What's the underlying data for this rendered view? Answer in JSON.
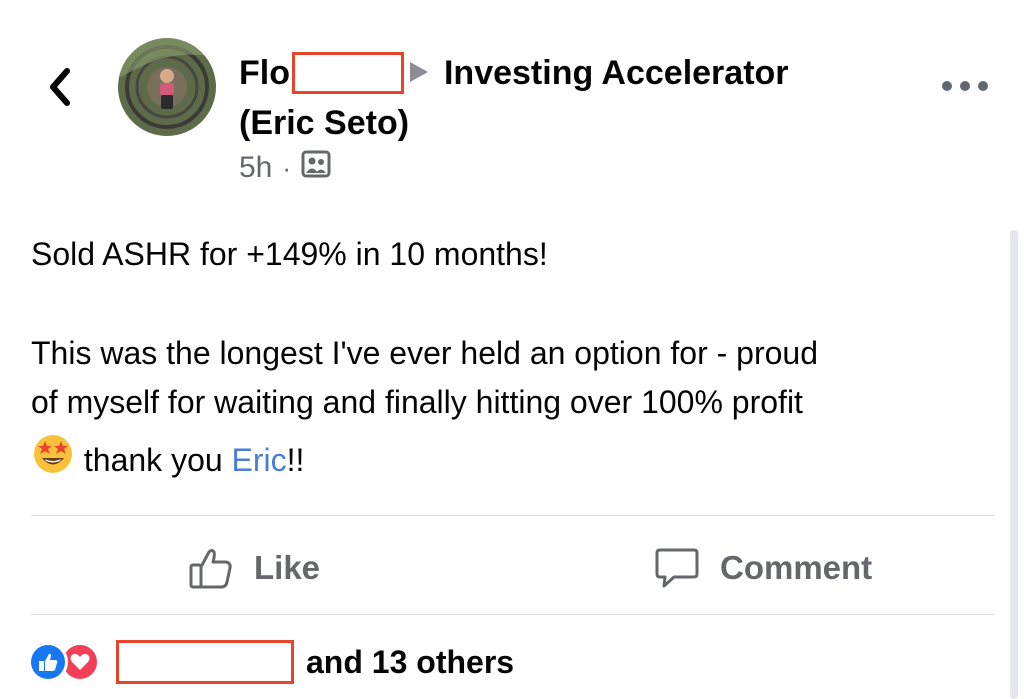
{
  "header": {
    "back_icon": "chevron-left-icon",
    "author_name_prefix": "Flo",
    "group_name": "Investing Accelerator",
    "group_owner": "(Eric Seto)",
    "timestamp": "5h",
    "separator": "·",
    "privacy_icon": "group-members-icon",
    "more_icon": "more-horizontal-icon"
  },
  "post": {
    "line1": "Sold ASHR for +149% in 10 months!",
    "line2": "This was the longest I've ever held an option for - proud",
    "line3": "of myself for waiting and finally hitting over 100% profit",
    "emoji": "star-struck-emoji",
    "thanks_text": " thank you ",
    "mention": "Eric",
    "exclaim": "!!"
  },
  "actions": {
    "like_label": "Like",
    "comment_label": "Comment"
  },
  "reactions": {
    "summary_text": "and 13 others",
    "types": [
      "like",
      "love"
    ]
  },
  "colors": {
    "redaction": "#e8432d",
    "mention": "#4a7ed6",
    "secondary_text": "#65676b",
    "like_blue": "#1877f2",
    "love_red": "#f33e58"
  }
}
